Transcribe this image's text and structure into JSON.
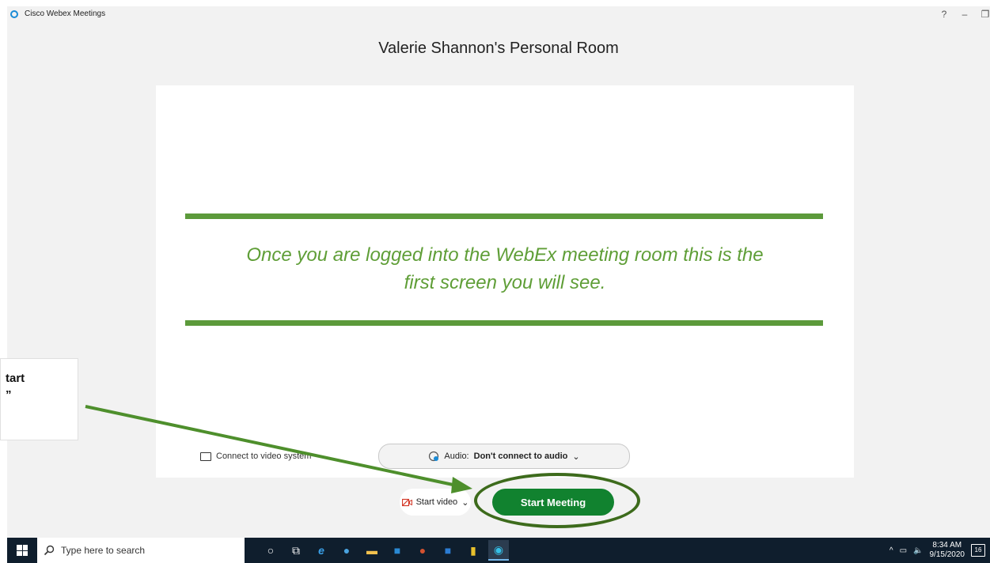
{
  "window": {
    "title": "Cisco Webex Meetings",
    "controls": {
      "help": "?",
      "minimize": "–",
      "restore": "❐"
    }
  },
  "room": {
    "title": "Valerie Shannon's Personal Room"
  },
  "preview": {
    "caption_line1": "Once you are logged into the WebEx meeting room this is the",
    "caption_line2": "first screen you will see."
  },
  "controls": {
    "connect_video_label": "Connect to video system",
    "audio_prefix": "Audio:",
    "audio_value": "Don't connect to audio",
    "start_video_label": "Start video",
    "start_meeting_label": "Start Meeting"
  },
  "callout": {
    "line1": "tart",
    "line2": "”"
  },
  "taskbar": {
    "search_placeholder": "Type here to search",
    "clock_time": "8:34 AM",
    "clock_date": "9/15/2020",
    "notification_count": "16"
  },
  "colors": {
    "accent_green": "#11822f",
    "caption_green": "#5f9e37",
    "highlight_ring": "#3d6b1c"
  }
}
